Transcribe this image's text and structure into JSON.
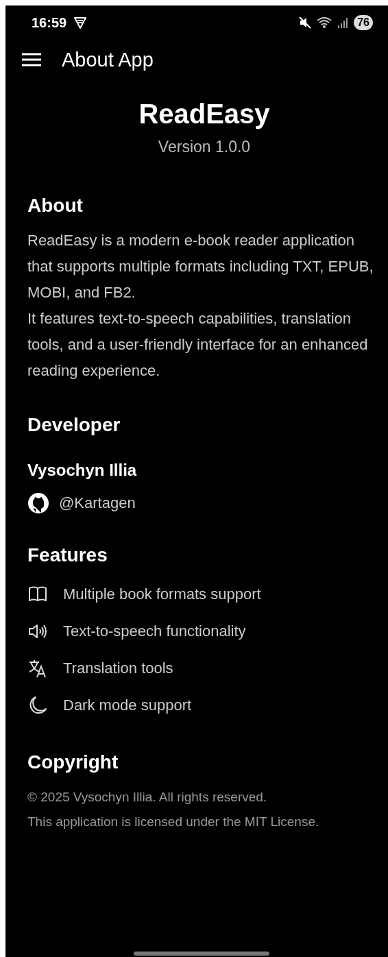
{
  "status_bar": {
    "time": "16:59",
    "battery": "76"
  },
  "app_bar": {
    "title": "About App"
  },
  "header": {
    "app_name": "ReadEasy",
    "version": "Version 1.0.0"
  },
  "about": {
    "heading": "About",
    "text": "ReadEasy is a modern e-book reader application that supports multiple formats including TXT, EPUB, MOBI, and FB2.\nIt features text-to-speech capabilities, translation tools, and a user-friendly interface for an enhanced reading experience."
  },
  "developer": {
    "heading": "Developer",
    "name": "Vysochyn Illia",
    "github": "@Kartagen"
  },
  "features": {
    "heading": "Features",
    "items": [
      {
        "kind": "book",
        "label": "Multiple book formats support"
      },
      {
        "kind": "speaker",
        "label": "Text-to-speech functionality"
      },
      {
        "kind": "translate",
        "label": "Translation tools"
      },
      {
        "kind": "moon",
        "label": "Dark mode support"
      }
    ]
  },
  "copyright": {
    "heading": "Copyright",
    "lines": [
      "© 2025 Vysochyn Illia. All rights reserved.",
      "This application is licensed under the MIT License."
    ]
  }
}
